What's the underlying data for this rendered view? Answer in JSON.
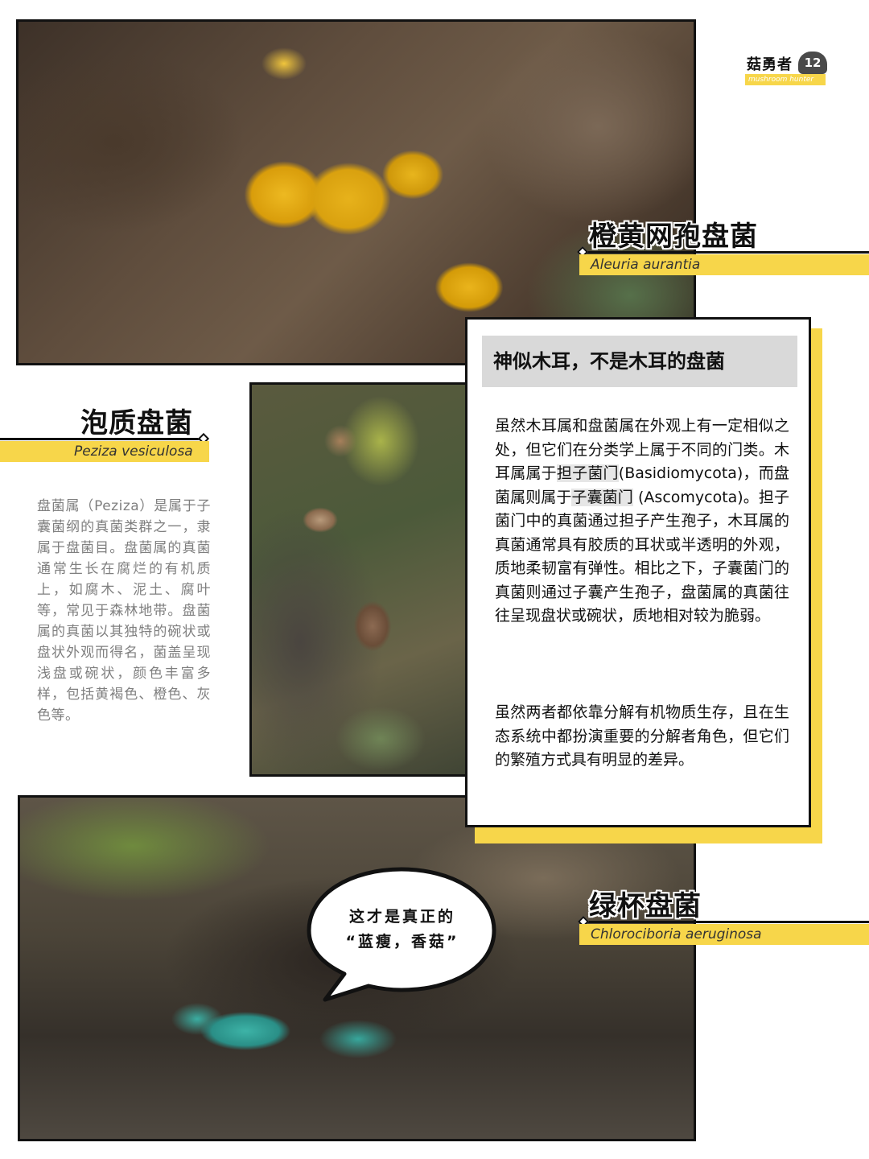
{
  "brand": {
    "name": "菇勇者",
    "number": "12",
    "subtitle": "mushroom hunter"
  },
  "species": [
    {
      "name_cn": "橙黄网孢盘菌",
      "name_latin": "Aleuria aurantia"
    },
    {
      "name_cn": "泡质盘菌",
      "name_latin": "Peziza vesiculosa"
    },
    {
      "name_cn": "绿杯盘菌",
      "name_latin": "Chlorociboria aeruginosa"
    }
  ],
  "left_text": "盘菌属（Peziza）是属于子囊菌纲的真菌类群之一，隶属于盘菌目。盘菌属的真菌通常生长在腐烂的有机质上，如腐木、泥土、腐叶等，常见于森林地带。盘菌属的真菌以其独特的碗状或盘状外观而得名，菌盖呈现浅盘或碗状，颜色丰富多样，包括黄褐色、橙色、灰色等。",
  "card": {
    "heading": "神似木耳，不是木耳的盘菌",
    "para1": {
      "p1": "虽然木耳属和盘菌属在外观上有一定相似之处，但它们在分类学上属于不同的门类。木耳属属于",
      "hl1": "担子菌门",
      "p2": "(Basidiomycota)，而盘菌属则属于",
      "hl2": "子囊菌门",
      "p3": " (Ascomycota)。担子菌门中的真菌通过担子产生孢子，木耳属的真菌通常具有胶质的耳状或半透明的外观，质地柔韧富有弹性。相比之下，子囊菌门的真菌则通过子囊产生孢子，盘菌属的真菌往往呈现盘状或碗状，质地相对较为脆弱。"
    },
    "para2": "虽然两者都依靠分解有机物质生存，且在生态系统中都扮演重要的分解者角色，但它们的繁殖方式具有明显的差异。"
  },
  "bubble": {
    "line1": "这才是真正的",
    "line2": "“蓝瘦，香菇”"
  },
  "colors": {
    "accent": "#f7d64a",
    "ink": "#111111",
    "muted_text": "#7f7f7f",
    "card_heading_bg": "#d9d9d9"
  }
}
